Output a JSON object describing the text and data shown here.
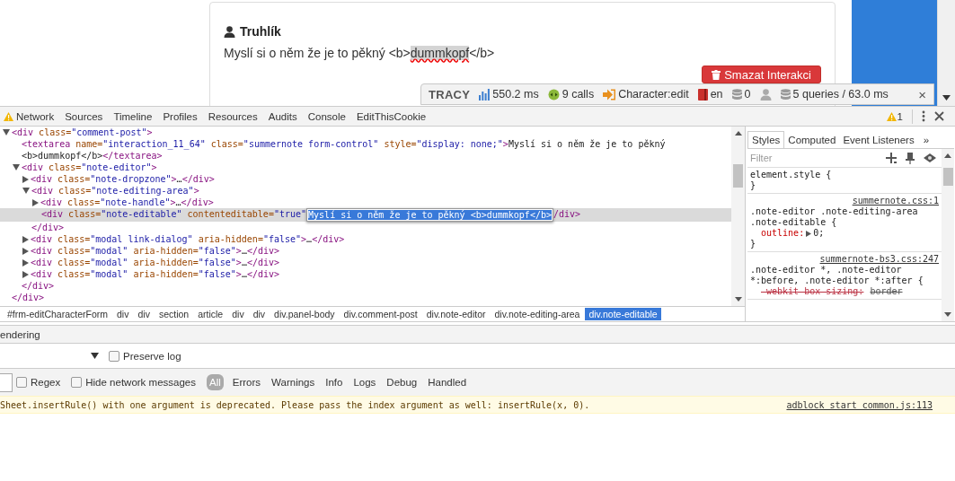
{
  "page": {
    "author": "Truhlík",
    "comment": {
      "before": "Myslí si o něm že je to pěkný <b>",
      "highlight": "dummkopf",
      "after": "</b>"
    },
    "delete_button": "Smazat Interakci"
  },
  "tracy": {
    "title": "TRACY",
    "items": [
      {
        "kind": "timer",
        "text": "550.2 ms"
      },
      {
        "kind": "calls",
        "text": "9 calls"
      },
      {
        "kind": "route",
        "text": "Character:edit"
      },
      {
        "kind": "lang",
        "text": "en"
      },
      {
        "kind": "db",
        "text": "0"
      },
      {
        "kind": "user"
      },
      {
        "kind": "db",
        "text": "5 queries / 63.0 ms"
      }
    ],
    "close": "×"
  },
  "devtools": {
    "tabs": [
      {
        "label": "Network",
        "selected": false,
        "warning": true
      },
      {
        "label": "Sources",
        "selected": false,
        "warning": false
      },
      {
        "label": "Timeline",
        "selected": false,
        "warning": false
      },
      {
        "label": "Profiles",
        "selected": false,
        "warning": false
      },
      {
        "label": "Resources",
        "selected": false,
        "warning": false
      },
      {
        "label": "Audits",
        "selected": false,
        "warning": false
      },
      {
        "label": "Console",
        "selected": false,
        "warning": false
      },
      {
        "label": "EditThisCookie",
        "selected": false,
        "warning": false
      }
    ],
    "warning_count": "1"
  },
  "elements": {
    "tree": [
      {
        "parts": [
          {
            "kind": "tag",
            "text": "<div"
          },
          {
            "kind": "attr",
            "text": " class="
          },
          {
            "kind": "value",
            "text": "\"comment-post\""
          },
          {
            "kind": "tag",
            "text": ">"
          }
        ],
        "expanded": true,
        "selected": false,
        "closing": "</div>",
        "children": [
          {
            "parts": [
              {
                "kind": "tag",
                "text": "<textarea"
              },
              {
                "kind": "attr",
                "text": " name="
              },
              {
                "kind": "value",
                "text": "\"interaction_11_64\""
              },
              {
                "kind": "attr",
                "text": " class="
              },
              {
                "kind": "value",
                "text": "\"summernote form-control\""
              },
              {
                "kind": "attr",
                "text": " style="
              },
              {
                "kind": "value",
                "text": "\"display: none;\""
              },
              {
                "kind": "tag",
                "text": ">"
              },
              {
                "kind": "text",
                "text": "Myslí si o něm že je to pěkný <b>dummkopf</b>"
              },
              {
                "kind": "tag",
                "text": "</textarea>"
              }
            ],
            "selected": false
          },
          {
            "parts": [
              {
                "kind": "tag",
                "text": "<div"
              },
              {
                "kind": "attr",
                "text": " class="
              },
              {
                "kind": "value",
                "text": "\"note-editor\""
              },
              {
                "kind": "tag",
                "text": ">"
              }
            ],
            "expanded": true,
            "selected": false,
            "closing": "</div>",
            "children": [
              {
                "parts": [
                  {
                    "kind": "tag",
                    "text": "<div"
                  },
                  {
                    "kind": "attr",
                    "text": " class="
                  },
                  {
                    "kind": "value",
                    "text": "\"note-dropzone\""
                  },
                  {
                    "kind": "tag",
                    "text": ">"
                  },
                  {
                    "kind": "text",
                    "text": "…"
                  },
                  {
                    "kind": "tag",
                    "text": "</div>"
                  }
                ],
                "expanded": false,
                "selected": false
              },
              {
                "parts": [
                  {
                    "kind": "tag",
                    "text": "<div"
                  },
                  {
                    "kind": "attr",
                    "text": " class="
                  },
                  {
                    "kind": "value",
                    "text": "\"note-editing-area\""
                  },
                  {
                    "kind": "tag",
                    "text": ">"
                  }
                ],
                "expanded": true,
                "selected": false,
                "closing": "</div>",
                "children": [
                  {
                    "parts": [
                      {
                        "kind": "tag",
                        "text": "<div"
                      },
                      {
                        "kind": "attr",
                        "text": " class="
                      },
                      {
                        "kind": "value",
                        "text": "\"note-handle\""
                      },
                      {
                        "kind": "tag",
                        "text": ">"
                      },
                      {
                        "kind": "text",
                        "text": "…"
                      },
                      {
                        "kind": "tag",
                        "text": "</div>"
                      }
                    ],
                    "expanded": false,
                    "selected": false
                  },
                  {
                    "parts": [
                      {
                        "kind": "tag",
                        "text": "<div"
                      },
                      {
                        "kind": "attr",
                        "text": " class="
                      },
                      {
                        "kind": "value",
                        "text": "\"note-editable\""
                      },
                      {
                        "kind": "attr",
                        "text": " contenteditable="
                      },
                      {
                        "kind": "value",
                        "text": "\"true\""
                      },
                      {
                        "kind": "edit",
                        "text": "Myslí si o něm že je to pěkný <b>dummkopf</b>"
                      },
                      {
                        "kind": "tag",
                        "text": "/div>"
                      }
                    ],
                    "selected": true
                  }
                ]
              },
              {
                "parts": [
                  {
                    "kind": "tag",
                    "text": "<div"
                  },
                  {
                    "kind": "attr",
                    "text": " class="
                  },
                  {
                    "kind": "value",
                    "text": "\"modal link-dialog\""
                  },
                  {
                    "kind": "attr",
                    "text": " aria-hidden="
                  },
                  {
                    "kind": "value",
                    "text": "\"false\""
                  },
                  {
                    "kind": "tag",
                    "text": ">"
                  },
                  {
                    "kind": "text",
                    "text": "…"
                  },
                  {
                    "kind": "tag",
                    "text": "</div>"
                  }
                ],
                "expanded": false,
                "selected": false
              },
              {
                "parts": [
                  {
                    "kind": "tag",
                    "text": "<div"
                  },
                  {
                    "kind": "attr",
                    "text": " class="
                  },
                  {
                    "kind": "value",
                    "text": "\"modal\""
                  },
                  {
                    "kind": "attr",
                    "text": " aria-hidden="
                  },
                  {
                    "kind": "value",
                    "text": "\"false\""
                  },
                  {
                    "kind": "tag",
                    "text": ">"
                  },
                  {
                    "kind": "text",
                    "text": "…"
                  },
                  {
                    "kind": "tag",
                    "text": "</div>"
                  }
                ],
                "expanded": false,
                "selected": false
              },
              {
                "parts": [
                  {
                    "kind": "tag",
                    "text": "<div"
                  },
                  {
                    "kind": "attr",
                    "text": " class="
                  },
                  {
                    "kind": "value",
                    "text": "\"modal\""
                  },
                  {
                    "kind": "attr",
                    "text": " aria-hidden="
                  },
                  {
                    "kind": "value",
                    "text": "\"false\""
                  },
                  {
                    "kind": "tag",
                    "text": ">"
                  },
                  {
                    "kind": "text",
                    "text": "…"
                  },
                  {
                    "kind": "tag",
                    "text": "</div>"
                  }
                ],
                "expanded": false,
                "selected": false
              },
              {
                "parts": [
                  {
                    "kind": "tag",
                    "text": "<div"
                  },
                  {
                    "kind": "attr",
                    "text": " class="
                  },
                  {
                    "kind": "value",
                    "text": "\"modal\""
                  },
                  {
                    "kind": "attr",
                    "text": " aria-hidden="
                  },
                  {
                    "kind": "value",
                    "text": "\"false\""
                  },
                  {
                    "kind": "tag",
                    "text": ">"
                  },
                  {
                    "kind": "text",
                    "text": "…"
                  },
                  {
                    "kind": "tag",
                    "text": "</div>"
                  }
                ],
                "expanded": false,
                "selected": false
              }
            ]
          }
        ]
      }
    ],
    "breadcrumbs": [
      {
        "label": "#frm-editCharacterForm",
        "selected": false
      },
      {
        "label": "div",
        "selected": false
      },
      {
        "label": "div",
        "selected": false
      },
      {
        "label": "section",
        "selected": false
      },
      {
        "label": "article",
        "selected": false
      },
      {
        "label": "div",
        "selected": false
      },
      {
        "label": "div",
        "selected": false
      },
      {
        "label": "div.panel-body",
        "selected": false
      },
      {
        "label": "div.comment-post",
        "selected": false
      },
      {
        "label": "div.note-editor",
        "selected": false
      },
      {
        "label": "div.note-editing-area",
        "selected": false
      },
      {
        "label": "div.note-editable",
        "selected": true
      }
    ]
  },
  "styles": {
    "tabs": [
      {
        "label": "Styles",
        "selected": true
      },
      {
        "label": "Computed",
        "selected": false
      },
      {
        "label": "Event Listeners",
        "selected": false
      }
    ],
    "more": "»",
    "filter_placeholder": "Filter",
    "rules": [
      {
        "selector": "element.style {",
        "close": "}"
      },
      {
        "selector": ".note-editor .note-editing-area .note-editable {",
        "source": "summernote.css:1",
        "close": "}",
        "declarations": [
          {
            "property": "outline:",
            "value": "0;",
            "expandable": true,
            "overridden": false
          }
        ]
      },
      {
        "selector": ".note-editor *, .note-editor *:before, .note-editor *:after {",
        "source": "summernote-bs3.css:247",
        "declarations": [
          {
            "property": "-webkit-box-sizing:",
            "value": "border",
            "expandable": false,
            "overridden": true
          }
        ]
      }
    ]
  },
  "drawer": {
    "tab": "endering",
    "preserve_log": {
      "label": "Preserve log",
      "checked": false
    },
    "regex": {
      "label": "Regex",
      "checked": false
    },
    "hide_network": {
      "label": "Hide network messages",
      "checked": false
    },
    "levels": [
      {
        "label": "All",
        "selected": true
      },
      {
        "label": "Errors",
        "selected": false
      },
      {
        "label": "Warnings",
        "selected": false
      },
      {
        "label": "Info",
        "selected": false
      },
      {
        "label": "Logs",
        "selected": false
      },
      {
        "label": "Debug",
        "selected": false
      },
      {
        "label": "Handled",
        "selected": false
      }
    ],
    "messages": [
      {
        "kind": "warning",
        "text": "Sheet.insertRule() with one argument is deprecated. Please pass the index argument as well: insertRule(x, 0).",
        "source": "adblock start common.js:113"
      }
    ]
  }
}
